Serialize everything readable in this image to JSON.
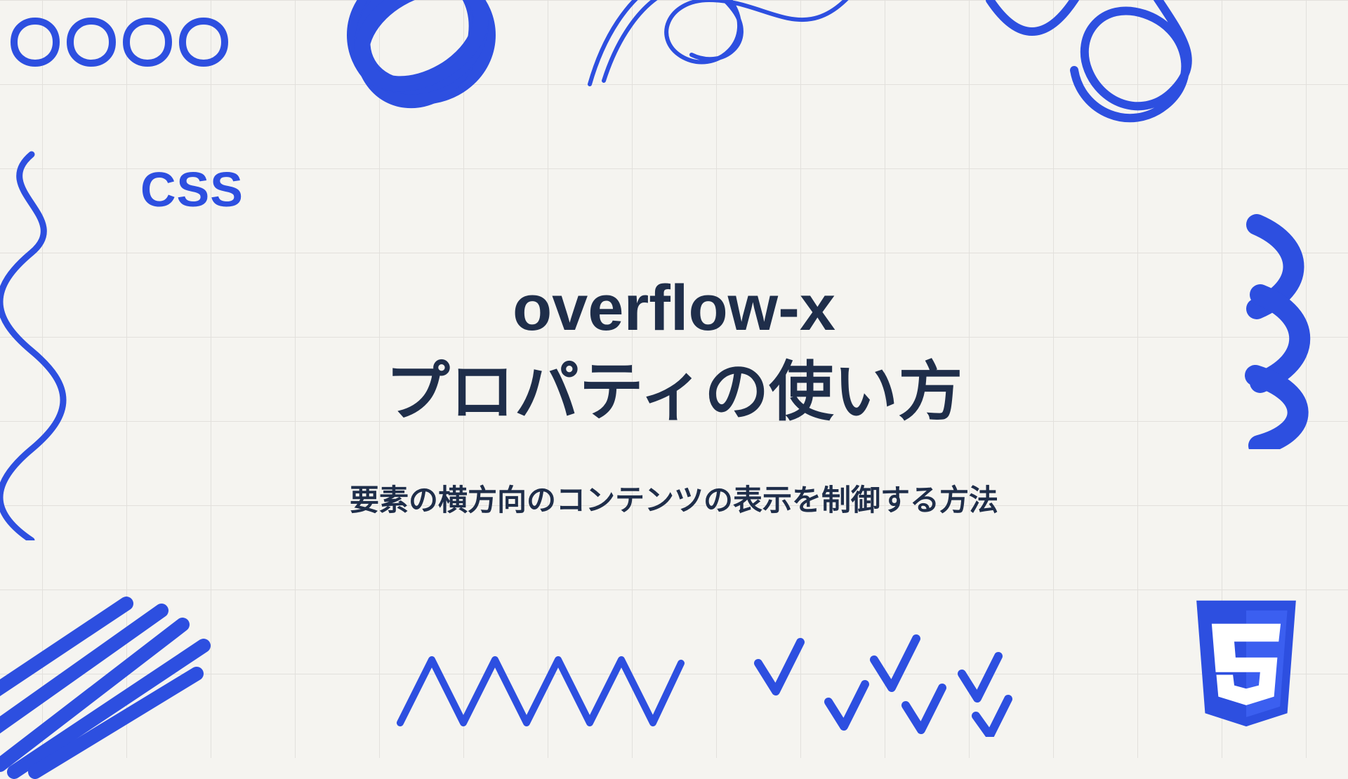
{
  "category": "CSS",
  "title_line1": "overflow-x",
  "title_line2": "プロパティの使い方",
  "subtitle": "要素の横方向のコンテンツの表示を制御する方法",
  "colors": {
    "accent": "#2d4fe0",
    "text": "#1f2e4a",
    "background": "#f5f4f0"
  },
  "logo": "css3"
}
